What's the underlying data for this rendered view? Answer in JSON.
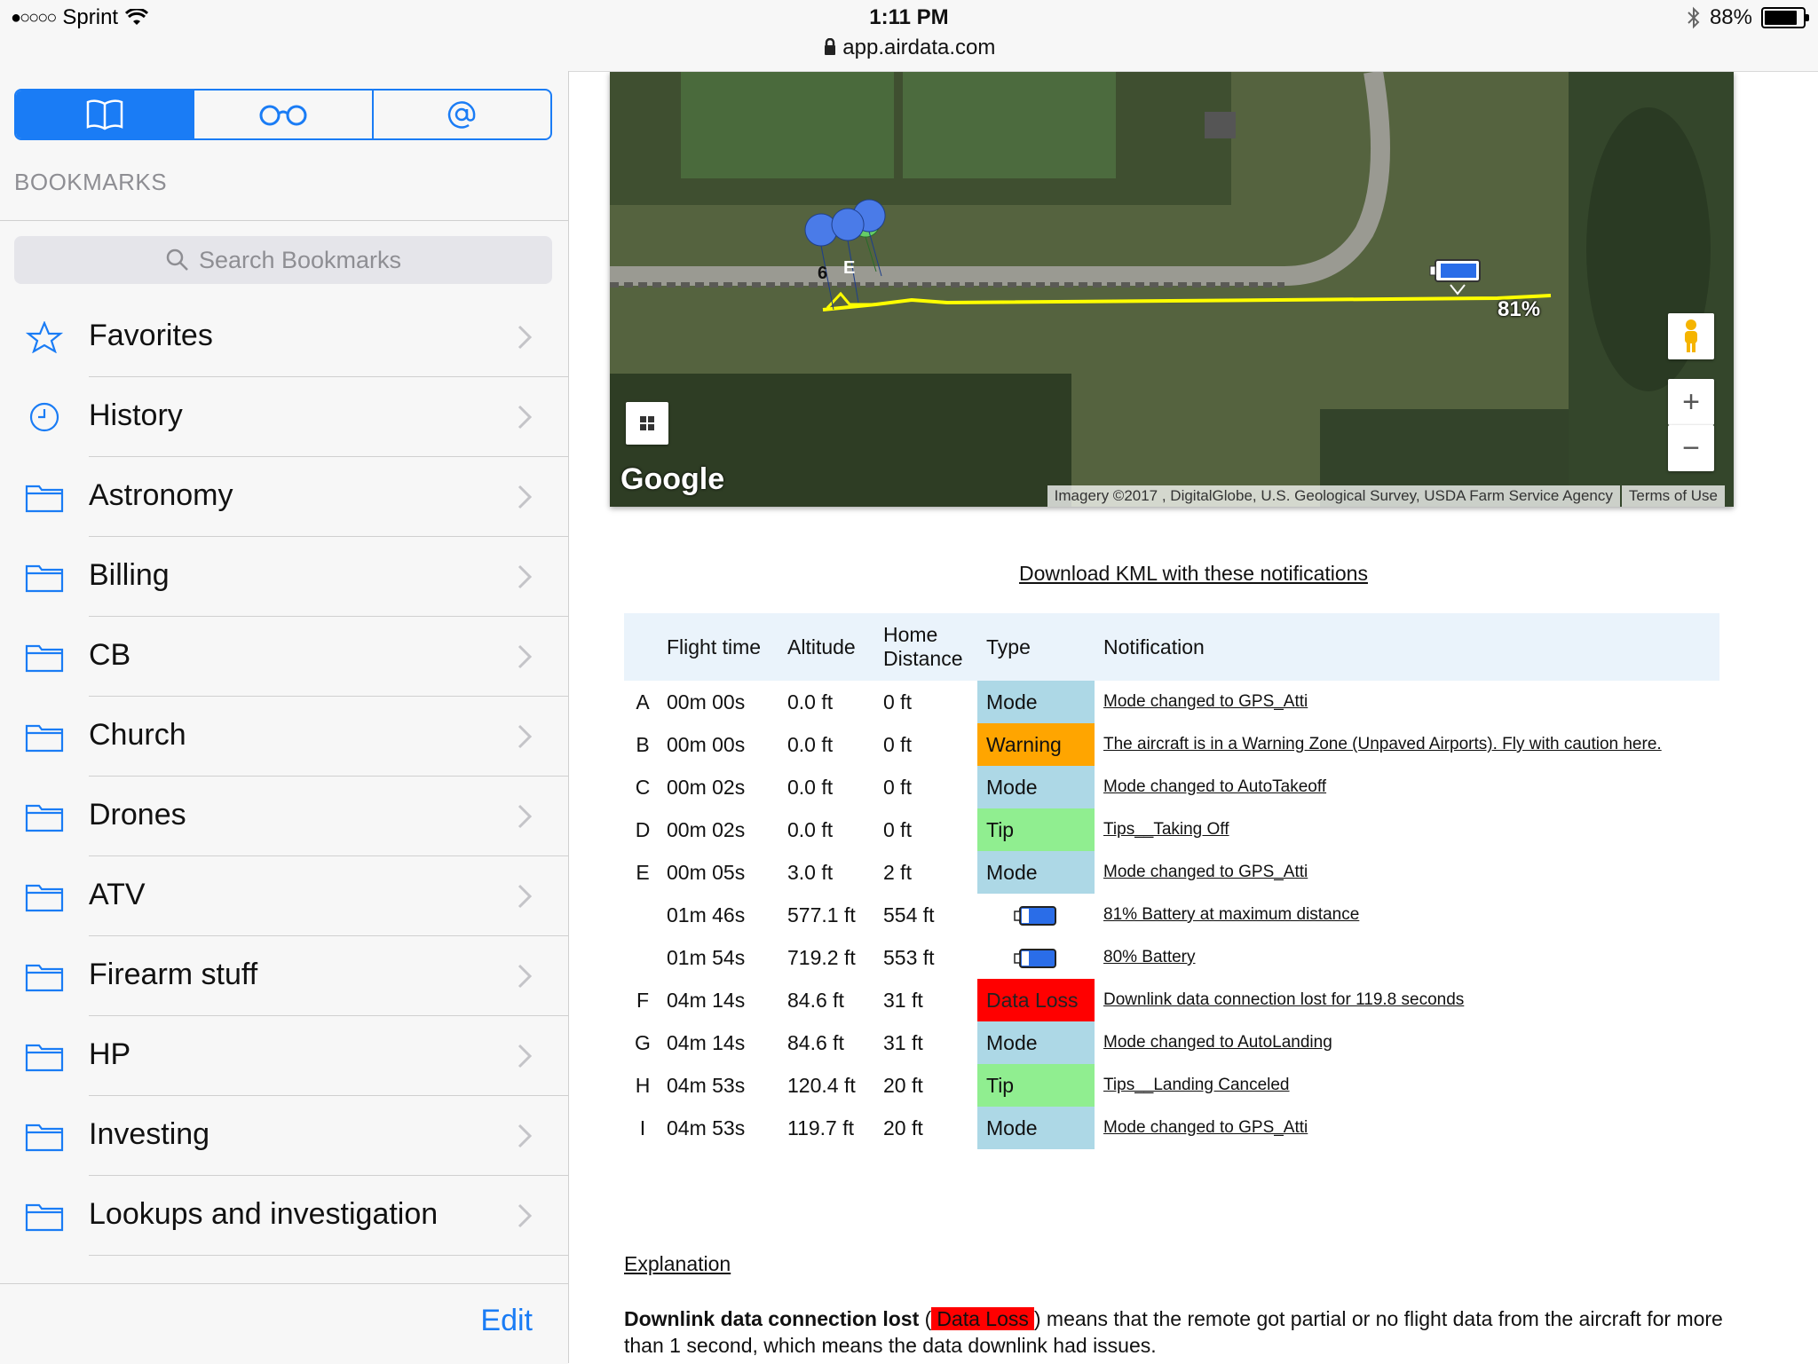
{
  "status": {
    "carrier": "Sprint",
    "signal": "●○○○○",
    "time": "1:11 PM",
    "url": "app.airdata.com",
    "battery": "88%"
  },
  "sidebar": {
    "tabs": [
      "bookmarks-icon",
      "reading-list-icon",
      "shared-links-icon"
    ],
    "header": "BOOKMARKS",
    "search_placeholder": "Search Bookmarks",
    "items": [
      {
        "label": "Favorites",
        "icon": "star-icon"
      },
      {
        "label": "History",
        "icon": "clock-icon"
      },
      {
        "label": "Astronomy",
        "icon": "folder-icon"
      },
      {
        "label": "Billing",
        "icon": "folder-icon"
      },
      {
        "label": "CB",
        "icon": "folder-icon"
      },
      {
        "label": "Church",
        "icon": "folder-icon"
      },
      {
        "label": "Drones",
        "icon": "folder-icon"
      },
      {
        "label": "ATV",
        "icon": "folder-icon"
      },
      {
        "label": "Firearm stuff",
        "icon": "folder-icon"
      },
      {
        "label": "HP",
        "icon": "folder-icon"
      },
      {
        "label": "Investing",
        "icon": "folder-icon"
      },
      {
        "label": "Lookups and investigation",
        "icon": "folder-icon"
      }
    ],
    "edit_label": "Edit"
  },
  "map": {
    "battery_label": "81%",
    "marker_labels": [
      "6",
      "E"
    ],
    "google": "Google",
    "attribution": "Imagery ©2017 , DigitalGlobe, U.S. Geological Survey, USDA Farm Service Agency",
    "terms": "Terms of Use",
    "zoom_in": "+",
    "zoom_out": "−"
  },
  "kml_link": "Download KML with these notifications",
  "table": {
    "headers": [
      "",
      "Flight time",
      "Altitude",
      "Home Distance",
      "Type",
      "Notification"
    ],
    "rows": [
      {
        "id": "A",
        "time": "00m 00s",
        "alt": "0.0 ft",
        "dist": "0 ft",
        "type": "Mode",
        "kind": "mode",
        "note": "Mode changed to GPS_Atti"
      },
      {
        "id": "B",
        "time": "00m 00s",
        "alt": "0.0 ft",
        "dist": "0 ft",
        "type": "Warning",
        "kind": "warn",
        "note": "The aircraft is in a Warning Zone (Unpaved Airports). Fly with caution here."
      },
      {
        "id": "C",
        "time": "00m 02s",
        "alt": "0.0 ft",
        "dist": "0 ft",
        "type": "Mode",
        "kind": "mode",
        "note": "Mode changed to AutoTakeoff"
      },
      {
        "id": "D",
        "time": "00m 02s",
        "alt": "0.0 ft",
        "dist": "0 ft",
        "type": "Tip",
        "kind": "tip",
        "note": "Tips__Taking Off"
      },
      {
        "id": "E",
        "time": "00m 05s",
        "alt": "3.0 ft",
        "dist": "2 ft",
        "type": "Mode",
        "kind": "mode",
        "note": "Mode changed to GPS_Atti"
      },
      {
        "id": "",
        "time": "01m 46s",
        "alt": "577.1 ft",
        "dist": "554 ft",
        "type": "",
        "kind": "battery",
        "note": "81% Battery at maximum distance"
      },
      {
        "id": "",
        "time": "01m 54s",
        "alt": "719.2 ft",
        "dist": "553 ft",
        "type": "",
        "kind": "battery",
        "note": "80% Battery"
      },
      {
        "id": "F",
        "time": "04m 14s",
        "alt": "84.6 ft",
        "dist": "31 ft",
        "type": "Data Loss",
        "kind": "loss",
        "note": "Downlink data connection lost for 119.8 seconds"
      },
      {
        "id": "G",
        "time": "04m 14s",
        "alt": "84.6 ft",
        "dist": "31 ft",
        "type": "Mode",
        "kind": "mode",
        "note": "Mode changed to AutoLanding"
      },
      {
        "id": "H",
        "time": "04m 53s",
        "alt": "120.4 ft",
        "dist": "20 ft",
        "type": "Tip",
        "kind": "tip",
        "note": "Tips__Landing Canceled"
      },
      {
        "id": "I",
        "time": "04m 53s",
        "alt": "119.7 ft",
        "dist": "20 ft",
        "type": "Mode",
        "kind": "mode",
        "note": "Mode changed to GPS_Atti"
      }
    ]
  },
  "explanation": {
    "title": "Explanation",
    "bold": "Downlink data connection lost",
    "open_paren": " (",
    "tag": "Data Loss",
    "text": ") means that the remote got partial or no flight data from the aircraft for more than 1 second, which means the data downlink had issues."
  }
}
